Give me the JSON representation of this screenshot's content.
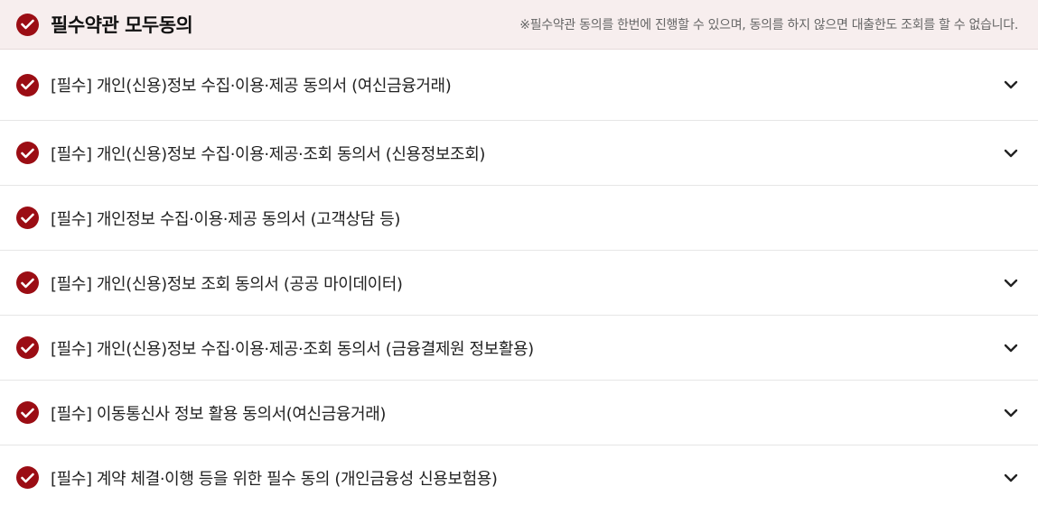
{
  "header": {
    "title": "필수약관 모두동의",
    "note": "※필수약관 동의를 한번에 진행할 수 있으며, 동의를 하지 않으면 대출한도 조회를 할 수 없습니다."
  },
  "colors": {
    "accent": "#9b0d14",
    "header_bg": "#f7eeee"
  },
  "agreements": [
    {
      "label": "[필수] 개인(신용)정보 수집·이용·제공 동의서 (여신금융거래)",
      "expandable": true
    },
    {
      "label": "[필수] 개인(신용)정보 수집·이용·제공·조회 동의서 (신용정보조회)",
      "expandable": true
    },
    {
      "label": "[필수] 개인정보 수집·이용·제공 동의서 (고객상담 등)",
      "expandable": false
    },
    {
      "label": "[필수] 개인(신용)정보 조회 동의서 (공공 마이데이터)",
      "expandable": true
    },
    {
      "label": "[필수] 개인(신용)정보 수집·이용·제공·조회 동의서 (금융결제원 정보활용)",
      "expandable": true
    },
    {
      "label": "[필수] 이동통신사 정보 활용 동의서(여신금융거래)",
      "expandable": true
    },
    {
      "label": "[필수] 계약 체결·이행 등을 위한 필수 동의 (개인금융성 신용보험용)",
      "expandable": true
    }
  ]
}
